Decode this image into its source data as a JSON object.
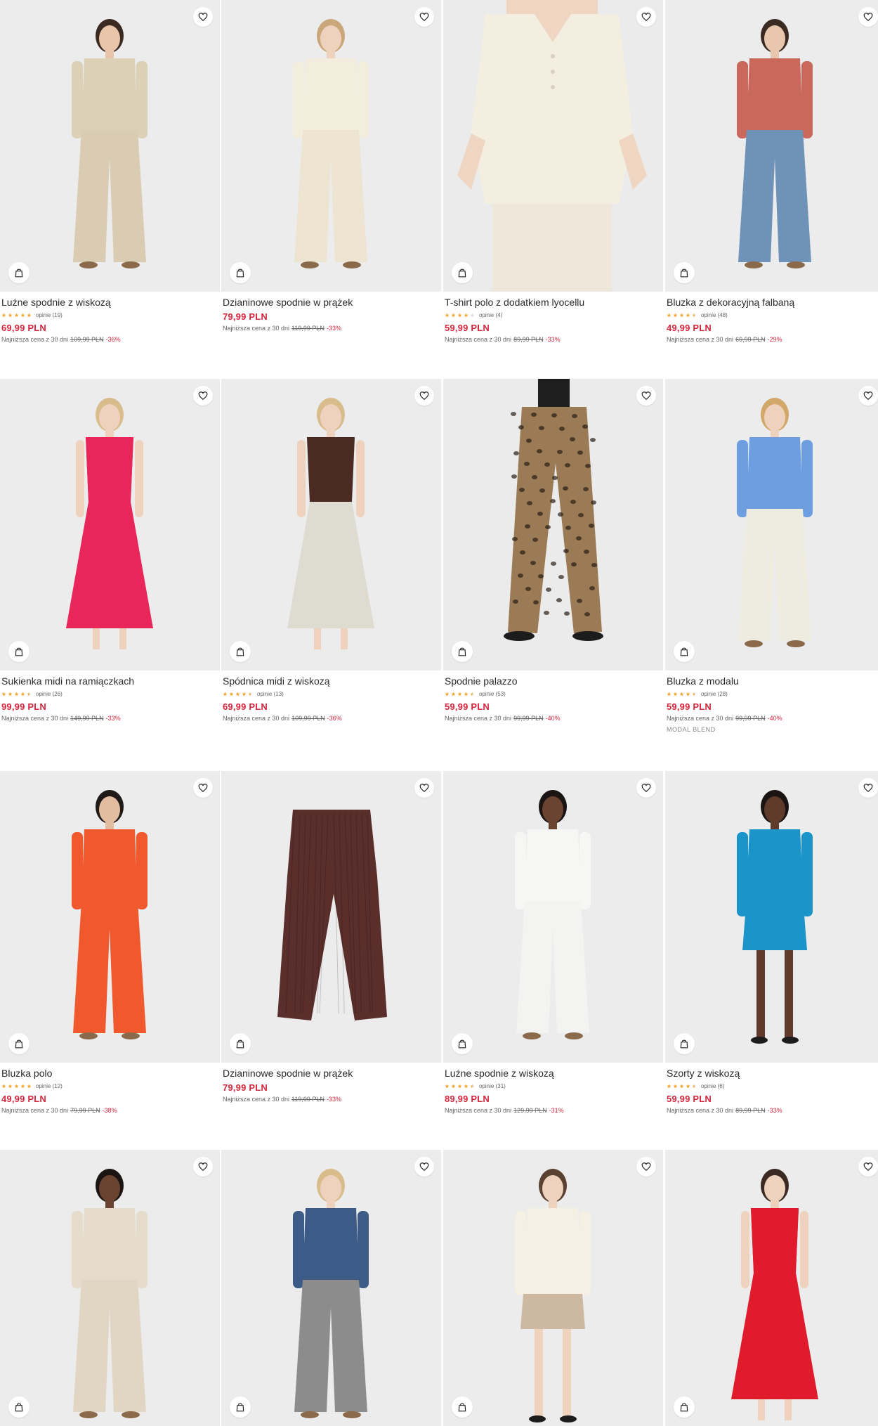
{
  "colors": {
    "accent": "#d7263d",
    "star": "#f2a531",
    "star_empty": "#dddddd",
    "background": "#e9e9e9"
  },
  "icons": {
    "favorite": "heart-icon",
    "add_to_cart": "shopping-bag-icon",
    "rating": "star-icon"
  },
  "lowest_price_label": "Najniższa cena z 30 dni",
  "products": [
    {
      "name": "Luźne spodnie z wiskozą",
      "rating": 5,
      "reviews": "opinie (19)",
      "price": "69,99 PLN",
      "old_price": "109,99 PLN",
      "discount": "-36%",
      "badge": null,
      "look": {
        "skin": "#e8c4a8",
        "hair": "#3a2a22",
        "top": "#dcd0b6",
        "bottom": "#d9ccb3",
        "bg": "#ececec",
        "style": "pants"
      }
    },
    {
      "name": "Dzianinowe spodnie w prążek",
      "rating": null,
      "reviews": null,
      "price": "79,99 PLN",
      "old_price": "119,99 PLN",
      "discount": "-33%",
      "badge": null,
      "look": {
        "skin": "#efd2bd",
        "hair": "#c9a77a",
        "top": "#f3eddd",
        "bottom": "#ede4d2",
        "bg": "#ececec",
        "style": "pants"
      }
    },
    {
      "name": "T-shirt polo z dodatkiem lyocellu",
      "rating": 4,
      "reviews": "opinie (4)",
      "price": "59,99 PLN",
      "old_price": "89,99 PLN",
      "discount": "-33%",
      "badge": null,
      "look": {
        "skin": "#efd6c2",
        "hair": "#d8c09a",
        "top": "#f4eee0",
        "bottom": "#efe8da",
        "bg": "#ebebeb",
        "style": "closeup"
      }
    },
    {
      "name": "Bluzka z dekoracyjną falbaną",
      "rating": 4.5,
      "reviews": "opinie (48)",
      "price": "49,99 PLN",
      "old_price": "69,99 PLN",
      "discount": "-29%",
      "badge": null,
      "look": {
        "skin": "#e9c7ae",
        "hair": "#3b2a22",
        "top": "#c9685b",
        "bottom": "#6f93b8",
        "bg": "#ececec",
        "style": "pants"
      }
    },
    {
      "name": "Sukienka midi na ramiączkach",
      "rating": 4.5,
      "reviews": "opinie (26)",
      "price": "99,99 PLN",
      "old_price": "149,99 PLN",
      "discount": "-33%",
      "badge": null,
      "look": {
        "skin": "#efd2bd",
        "hair": "#d9bc8c",
        "top": "#e8265a",
        "bottom": "#e8265a",
        "bg": "#ececec",
        "style": "dress"
      }
    },
    {
      "name": "Spódnica midi z wiskozą",
      "rating": 4.5,
      "reviews": "opinie (13)",
      "price": "69,99 PLN",
      "old_price": "109,99 PLN",
      "discount": "-36%",
      "badge": null,
      "look": {
        "skin": "#efd2bd",
        "hair": "#d9bc8c",
        "top": "#4a2a22",
        "bottom": "#dedbd0",
        "bg": "#ececec",
        "style": "dress"
      }
    },
    {
      "name": "Spodnie palazzo",
      "rating": 4.5,
      "reviews": "opinie (53)",
      "price": "59,99 PLN",
      "old_price": "99,99 PLN",
      "discount": "-40%",
      "badge": null,
      "look": {
        "skin": "#efd6c2",
        "hair": "#222222",
        "top": "#1e1e1e",
        "bottom": "#9b7b55",
        "bg": "#ebebeb",
        "style": "legs"
      }
    },
    {
      "name": "Bluzka z modalu",
      "rating": 4.5,
      "reviews": "opinie (28)",
      "price": "59,99 PLN",
      "old_price": "99,99 PLN",
      "discount": "-40%",
      "badge": "MODAL BLEND",
      "look": {
        "skin": "#efd2bd",
        "hair": "#d2a86a",
        "top": "#6d9ee0",
        "bottom": "#eeebdf",
        "bg": "#ececec",
        "style": "pants"
      }
    },
    {
      "name": "Bluzka polo",
      "rating": 5,
      "reviews": "opinie (12)",
      "price": "49,99 PLN",
      "old_price": "79,99 PLN",
      "discount": "-38%",
      "badge": null,
      "look": {
        "skin": "#e3bd9f",
        "hair": "#1f1a18",
        "top": "#f0582e",
        "bottom": "#f0582e",
        "bg": "#ececec",
        "style": "pants"
      }
    },
    {
      "name": "Dzianinowe spodnie w prążek",
      "rating": null,
      "reviews": null,
      "price": "79,99 PLN",
      "old_price": "119,99 PLN",
      "discount": "-33%",
      "badge": null,
      "look": {
        "skin": "#e9e9e9",
        "hair": "#e9e9e9",
        "top": "#e9e9e9",
        "bottom": "#5a2e2a",
        "bg": "#ececec",
        "style": "flat"
      }
    },
    {
      "name": "Luźne spodnie z wiskozą",
      "rating": 4.5,
      "reviews": "opinie (31)",
      "price": "89,99 PLN",
      "old_price": "129,99 PLN",
      "discount": "-31%",
      "badge": null,
      "look": {
        "skin": "#6b4431",
        "hair": "#1a1412",
        "top": "#f6f6f4",
        "bottom": "#f3f3f1",
        "bg": "#ececec",
        "style": "pants"
      }
    },
    {
      "name": "Szorty z wiskozą",
      "rating": 4.5,
      "reviews": "opinie (6)",
      "price": "59,99 PLN",
      "old_price": "89,99 PLN",
      "discount": "-33%",
      "badge": null,
      "look": {
        "skin": "#5e3b2a",
        "hair": "#1a1412",
        "top": "#1b95c9",
        "bottom": "#1b95c9",
        "bg": "#ececec",
        "style": "shorts"
      }
    },
    {
      "name": "",
      "rating": null,
      "reviews": null,
      "price": "",
      "old_price": "",
      "discount": "",
      "badge": null,
      "look": {
        "skin": "#6b4431",
        "hair": "#1a1412",
        "top": "#e6dccb",
        "bottom": "#e1d6c4",
        "bg": "#ececec",
        "style": "pants"
      }
    },
    {
      "name": "",
      "rating": null,
      "reviews": null,
      "price": "",
      "old_price": "",
      "discount": "",
      "badge": null,
      "look": {
        "skin": "#efd2bd",
        "hair": "#d9bc8c",
        "top": "#3c5b86",
        "bottom": "#8c8c8c",
        "bg": "#ececec",
        "style": "pants"
      }
    },
    {
      "name": "",
      "rating": null,
      "reviews": null,
      "price": "",
      "old_price": "",
      "discount": "",
      "badge": null,
      "look": {
        "skin": "#efd2bd",
        "hair": "#5a4232",
        "top": "#f4f0e3",
        "bottom": "#cdb8a2",
        "bg": "#ececec",
        "style": "shorts"
      }
    },
    {
      "name": "",
      "rating": null,
      "reviews": null,
      "price": "",
      "old_price": "",
      "discount": "",
      "badge": null,
      "look": {
        "skin": "#efd2bd",
        "hair": "#3b2a22",
        "top": "#e01b2c",
        "bottom": "#e01b2c",
        "bg": "#ececec",
        "style": "dress"
      }
    }
  ]
}
